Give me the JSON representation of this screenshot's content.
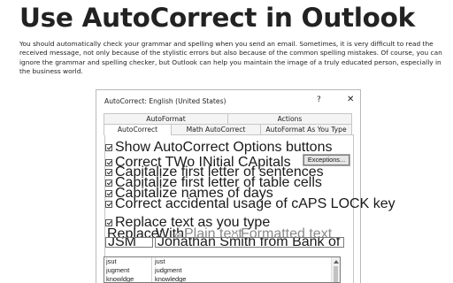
{
  "article": {
    "title": "Use AutoCorrect in Outlook",
    "description": "You should automatically check your grammar and spelling when you send an email. Sometimes, it is very difficult to read the received message, not only because of the stylistic errors but also because of the common spelling mistakes. Of course, you can ignore the grammar and spelling checker, but Outlook can help you maintain the image of a truly educated person, especially in the business world."
  },
  "dialog": {
    "title": "AutoCorrect: English (United States)",
    "help_glyph": "?",
    "close_glyph": "✕",
    "tabs_upper": [
      "AutoFormat",
      "Actions"
    ],
    "tabs_lower": [
      "AutoCorrect",
      "Math AutoCorrect",
      "AutoFormat As You Type"
    ],
    "active_tab": "AutoCorrect",
    "options": {
      "show_buttons": "Show AutoCorrect Options buttons",
      "two_initial_caps": "Correct TWo INitial CApitals",
      "first_letter_sentences": "Capitalize first letter of sentences",
      "first_letter_table_cells": "Capitalize first letter of table cells",
      "names_of_days": "Capitalize names of days",
      "caps_lock": "Correct accidental usage of cAPS LOCK key",
      "replace_as_you_type": "Replace text as you type"
    },
    "exceptions_label": "Exceptions...",
    "replace_label": "Replace:",
    "with_label": "With:",
    "plain_text_label": "Plain text",
    "formatted_text_label": "Formatted text",
    "replace_value": "JSM",
    "with_value": "Jonathan Smith from Bank of America",
    "entries": [
      {
        "replace": "jsut",
        "with": "just"
      },
      {
        "replace": "jugment",
        "with": "judgment"
      },
      {
        "replace": "knowldge",
        "with": "knowledge"
      }
    ]
  }
}
